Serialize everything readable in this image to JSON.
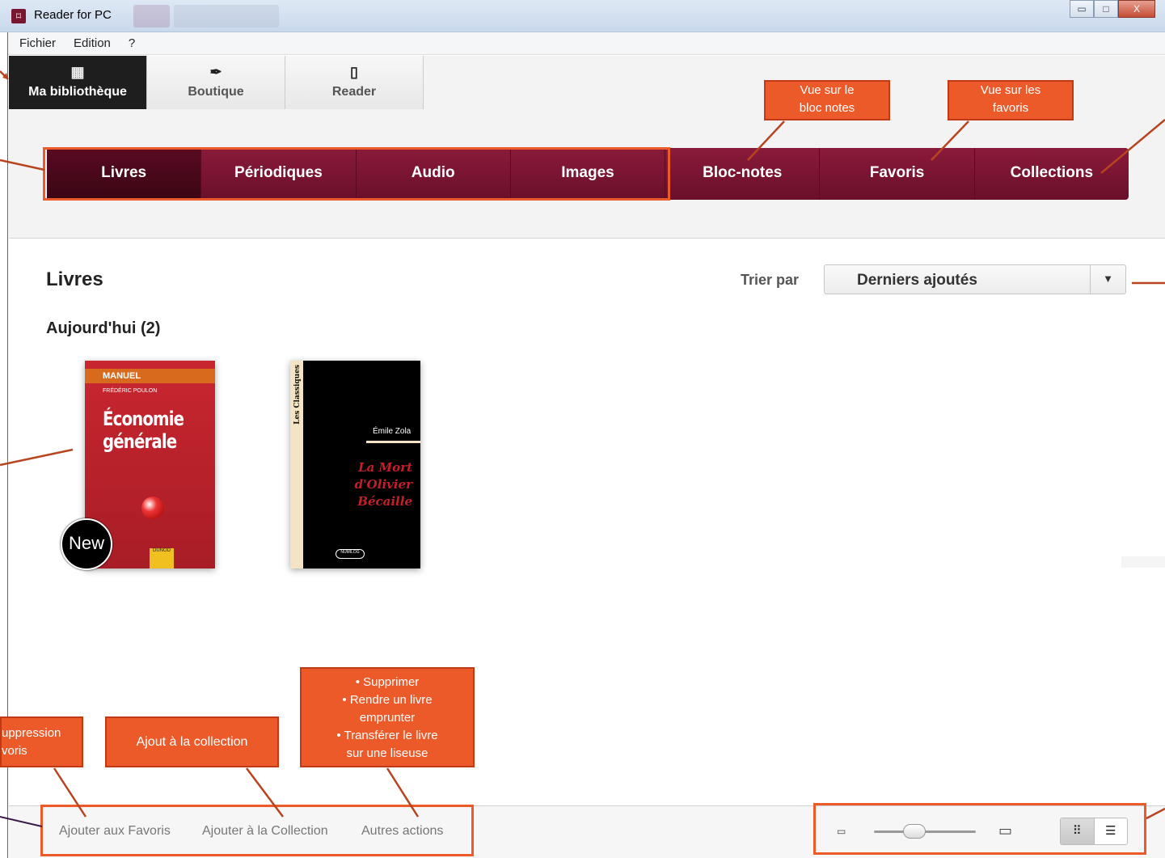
{
  "window": {
    "title": "Reader for PC",
    "controls": {
      "minimize": "▭",
      "maximize": "□",
      "close": "X"
    }
  },
  "menu": [
    "Fichier",
    "Edition",
    "?"
  ],
  "nav_tabs": [
    {
      "label": "Ma bibliothèque",
      "icon": "library-icon",
      "active": true
    },
    {
      "label": "Boutique",
      "icon": "feather-icon",
      "active": false
    },
    {
      "label": "Reader",
      "icon": "tablet-icon",
      "active": false
    }
  ],
  "categories": [
    {
      "label": "Livres",
      "active": true
    },
    {
      "label": "Périodiques",
      "active": false
    },
    {
      "label": "Audio",
      "active": false
    },
    {
      "label": "Images",
      "active": false
    },
    {
      "label": "Bloc-notes",
      "active": false
    },
    {
      "label": "Favoris",
      "active": false
    },
    {
      "label": "Collections",
      "active": false
    }
  ],
  "content": {
    "section_title": "Livres",
    "sort_label": "Trier par",
    "sort_value": "Derniers ajoutés",
    "group_title": "Aujourd'hui (2)"
  },
  "books": [
    {
      "series": "MANUEL",
      "author": "FRÉDÉRIC POULON",
      "title_line1": "Économie",
      "title_line2": "générale",
      "publisher": "DUNOD",
      "badge": "New",
      "cover_color": "#c9262f"
    },
    {
      "spine": "Les Classiques",
      "author": "Émile Zola",
      "title_line1": "La Mort",
      "title_line2": "d'Olivier",
      "title_line3": "Bécaille",
      "publisher": "NUMILOG",
      "cover_color": "#000000"
    }
  ],
  "bottom_actions": [
    "Ajouter aux Favoris",
    "Ajouter à la Collection",
    "Autres actions"
  ],
  "view": {
    "grid_icon": "grid-view-icon",
    "list_icon": "list-view-icon",
    "zoom_level": 0.4
  },
  "callouts": {
    "notes": [
      "Vue sur le",
      "bloc notes"
    ],
    "favorites": [
      "Vue sur les",
      "favoris"
    ],
    "suppression": [
      "uppression",
      "voris"
    ],
    "collection": "Ajout à la collection",
    "other": [
      "• Supprimer",
      "• Rendre un livre",
      "emprunter",
      "• Transférer le livre",
      "sur une liseuse"
    ]
  },
  "colors": {
    "accent": "#7a1530",
    "annotation": "#ec5a2a",
    "active_tab": "#1e1e1e"
  }
}
